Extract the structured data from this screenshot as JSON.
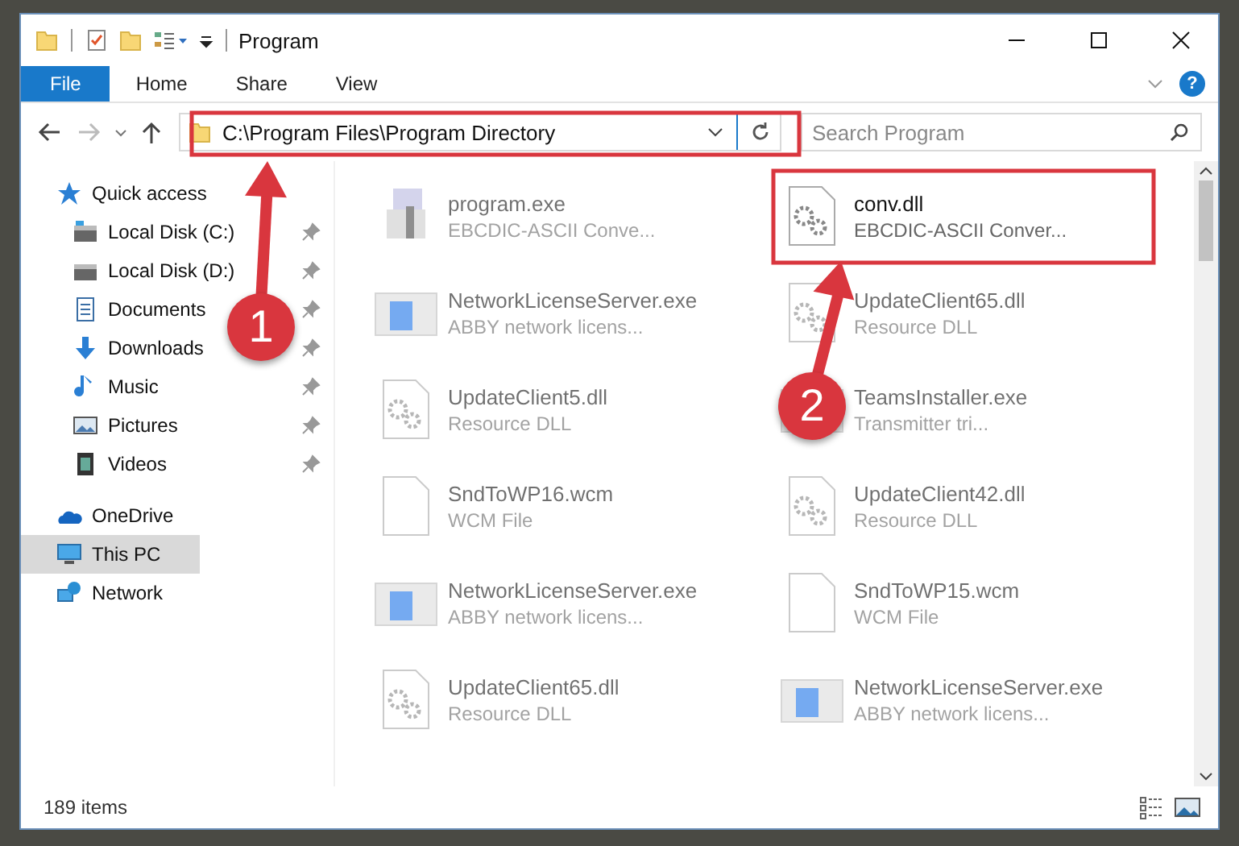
{
  "window": {
    "title": "Program"
  },
  "ribbon": {
    "tabs": [
      {
        "label": "File",
        "selected": true
      },
      {
        "label": "Home",
        "selected": false
      },
      {
        "label": "Share",
        "selected": false
      },
      {
        "label": "View",
        "selected": false
      }
    ],
    "help_label": "?"
  },
  "address": {
    "path": "C:\\Program Files\\Program Directory",
    "search_placeholder": "Search Program"
  },
  "sidebar": {
    "items": [
      {
        "label": "Quick access",
        "kind": "star",
        "pinned": false,
        "selected": false,
        "children": [
          {
            "label": "Local Disk (C:)",
            "kind": "drive-c",
            "pinned": true,
            "selected": false
          },
          {
            "label": "Local Disk (D:)",
            "kind": "drive",
            "pinned": true,
            "selected": false
          },
          {
            "label": "Documents",
            "kind": "document",
            "pinned": true,
            "selected": false
          },
          {
            "label": "Downloads",
            "kind": "download",
            "pinned": true,
            "selected": false
          },
          {
            "label": "Music",
            "kind": "music",
            "pinned": true,
            "selected": false
          },
          {
            "label": "Pictures",
            "kind": "picture",
            "pinned": true,
            "selected": false
          },
          {
            "label": "Videos",
            "kind": "video",
            "pinned": true,
            "selected": false
          }
        ]
      },
      {
        "label": "OneDrive",
        "kind": "cloud",
        "pinned": false,
        "selected": false
      },
      {
        "label": "This PC",
        "kind": "pc",
        "pinned": false,
        "selected": true
      },
      {
        "label": "Network",
        "kind": "network",
        "pinned": false,
        "selected": false
      }
    ]
  },
  "files": [
    {
      "name": "program.exe",
      "description": "EBCDIC-ASCII Conve...",
      "kind": "setup",
      "faded": true
    },
    {
      "name": "conv.dll",
      "description": "EBCDIC-ASCII Conver...",
      "kind": "dll",
      "faded": false
    },
    {
      "name": "NetworkLicenseServer.exe",
      "description": "ABBY network licens...",
      "kind": "app",
      "faded": true
    },
    {
      "name": "UpdateClient65.dll",
      "description": "Resource DLL",
      "kind": "dll",
      "faded": true
    },
    {
      "name": "UpdateClient5.dll",
      "description": "Resource DLL",
      "kind": "dll",
      "faded": true
    },
    {
      "name": "TeamsInstaller.exe",
      "description": "Transmitter tri...",
      "kind": "app",
      "faded": true
    },
    {
      "name": "SndToWP16.wcm",
      "description": "WCM File",
      "kind": "blank",
      "faded": true
    },
    {
      "name": "UpdateClient42.dll",
      "description": "Resource DLL",
      "kind": "dll",
      "faded": true
    },
    {
      "name": "NetworkLicenseServer.exe",
      "description": "ABBY network licens...",
      "kind": "app",
      "faded": true
    },
    {
      "name": "SndToWP15.wcm",
      "description": "WCM File",
      "kind": "blank",
      "faded": true
    },
    {
      "name": "UpdateClient65.dll",
      "description": "Resource DLL",
      "kind": "dll",
      "faded": true
    },
    {
      "name": "NetworkLicenseServer.exe",
      "description": "ABBY network licens...",
      "kind": "app",
      "faded": true
    }
  ],
  "status_bar": {
    "count": "189 items"
  },
  "annotations": [
    {
      "number": "1"
    },
    {
      "number": "2"
    }
  ]
}
